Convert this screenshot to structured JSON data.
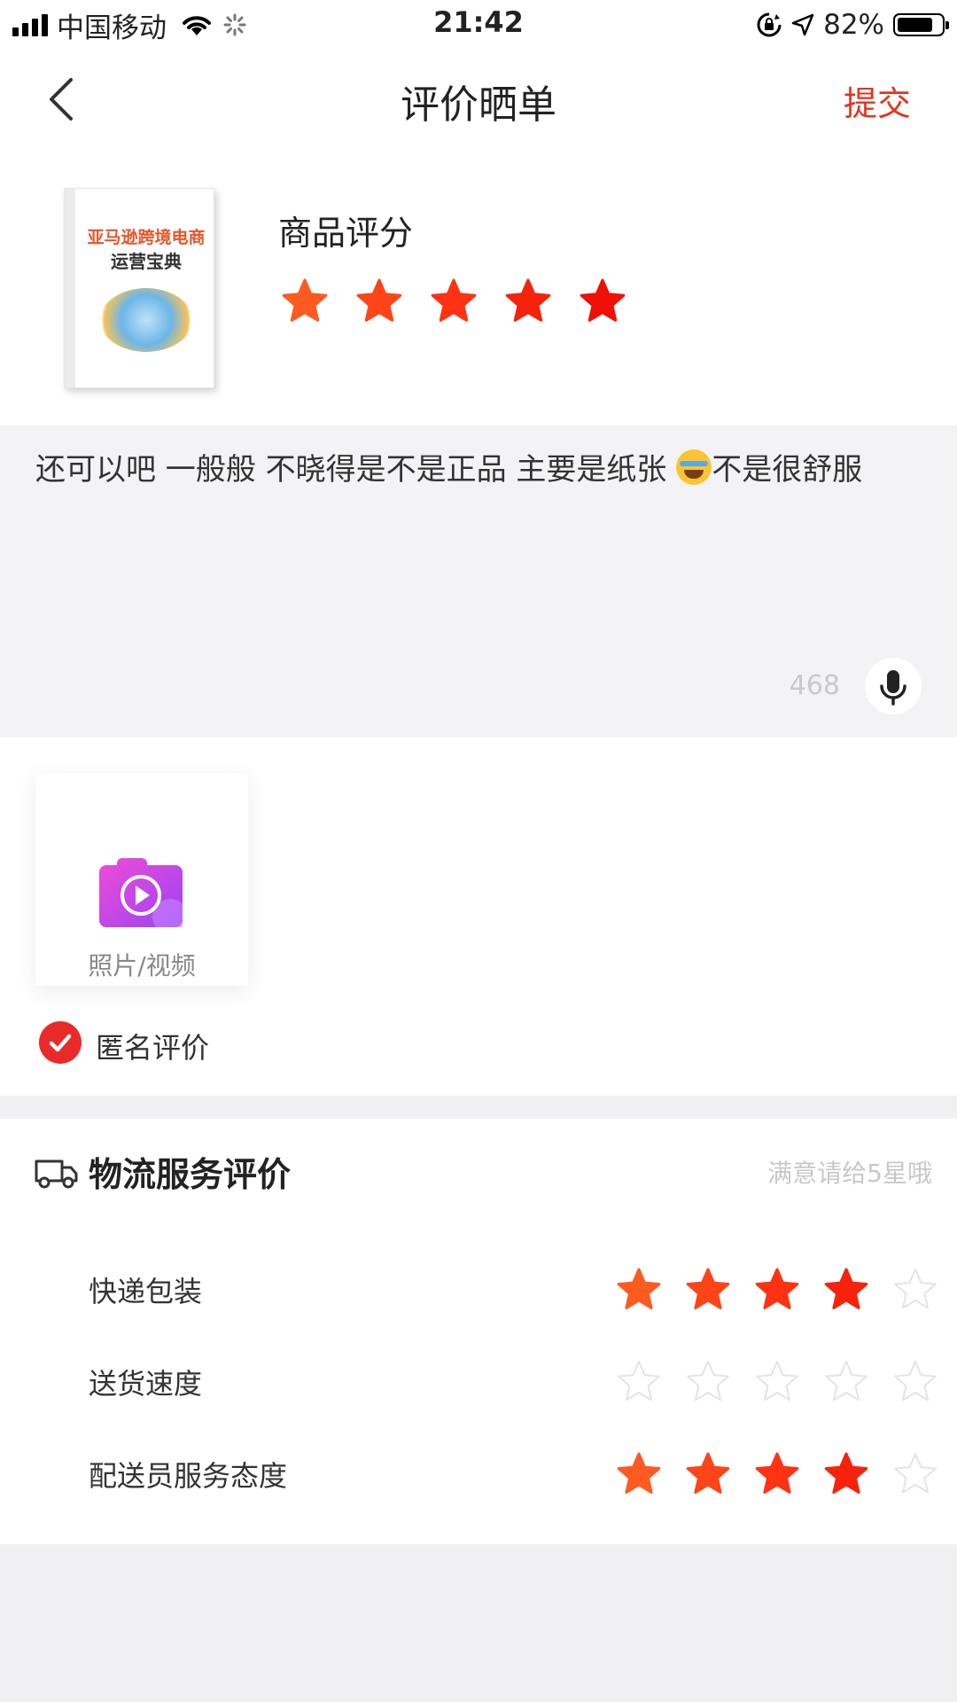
{
  "status_bar": {
    "carrier": "中国移动",
    "time": "21:42",
    "battery": "82%",
    "battery_level": 0.82,
    "icons": [
      "signal-icon",
      "wifi-icon",
      "loading-icon",
      "orientation-lock-icon",
      "location-arrow-icon",
      "battery-icon"
    ]
  },
  "nav": {
    "title": "评价晒单",
    "back_icon": "chevron-left-icon",
    "submit_label": "提交"
  },
  "product": {
    "cover_title_line1": "亚马逊跨境电商",
    "cover_title_line2": "运营宝典",
    "rating_label": "商品评分",
    "rating": 5,
    "max_rating": 5
  },
  "review": {
    "text_before_emoji": "还可以吧 一般般 不晓得是不是正品 主要是纸张 ",
    "emoji": "face-with-tears-of-joy",
    "text_after_emoji": "不是很舒服",
    "remaining_count": "468",
    "mic_icon": "microphone-icon"
  },
  "media": {
    "upload_label": "照片/视频",
    "upload_icon": "camera-video-icon",
    "anonymous_label": "匿名评价",
    "anonymous_checked": true
  },
  "logistics": {
    "title": "物流服务评价",
    "hint": "满意请给5星哦",
    "icon": "truck-icon",
    "items": [
      {
        "label": "快递包装",
        "rating": 4
      },
      {
        "label": "送货速度",
        "rating": 0
      },
      {
        "label": "配送员服务态度",
        "rating": 4
      }
    ],
    "max_rating": 5
  },
  "colors": {
    "accent": "#e8321f",
    "star_gradient": [
      "#ff5a1f",
      "#ff4418",
      "#ff3312",
      "#f7220c",
      "#f01006"
    ],
    "star_empty_stroke": "#e4e4e4",
    "page_bg": "#f0f0f3"
  }
}
